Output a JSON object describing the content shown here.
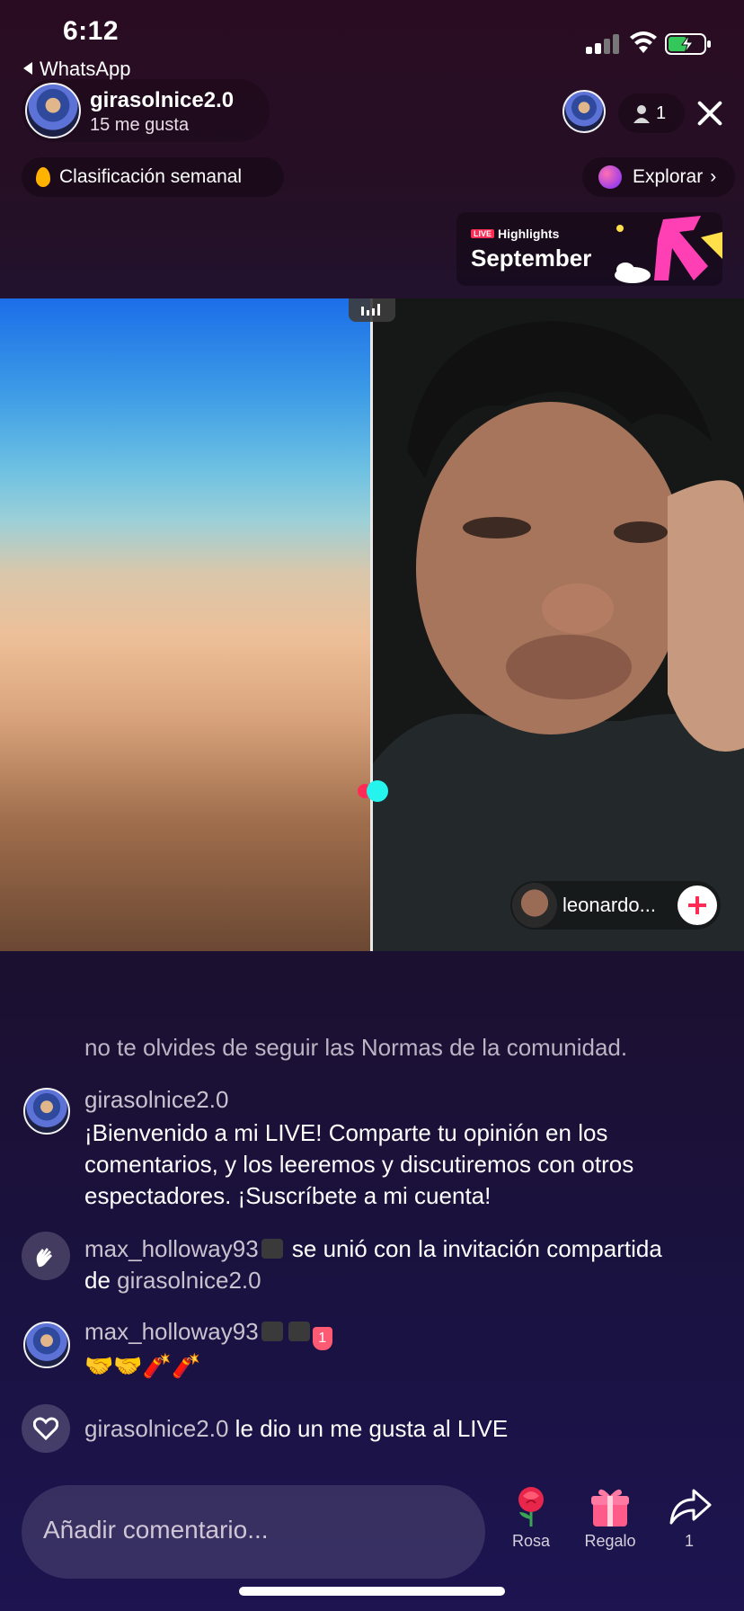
{
  "status_bar": {
    "time": "6:12",
    "back_app": "WhatsApp"
  },
  "host": {
    "name": "girasolnice2.0",
    "likes": "15 me gusta"
  },
  "viewers": {
    "count": "1"
  },
  "weekly_ranking": {
    "label": "Clasificación semanal"
  },
  "explore": {
    "label": "Explorar"
  },
  "highlights": {
    "badge": "LIVE",
    "title": "Highlights",
    "month": "September"
  },
  "guest": {
    "name": "leonardo..."
  },
  "chat": {
    "notice": "no te olvides de seguir las Normas de la comunidad.",
    "messages": [
      {
        "user": "girasolnice2.0",
        "text": "¡Bienvenido a mi LIVE! Comparte tu opinión en los comentarios, y los leeremos y discutiremos con otros espectadores. ¡Suscríbete a mi cuenta!"
      },
      {
        "user": "max_holloway93",
        "text": "se unió con la invitación compartida",
        "text2": "de",
        "ref_user": "girasolnice2.0"
      },
      {
        "user": "max_holloway93",
        "text": "🤝🤝🧨🧨",
        "rank_badge": "1"
      },
      {
        "user": "girasolnice2.0",
        "text": "le dio un me gusta al LIVE"
      }
    ]
  },
  "composer": {
    "placeholder": "Añadir comentario..."
  },
  "actions": {
    "rose": "Rosa",
    "gift": "Regalo",
    "share_count": "1"
  },
  "colors": {
    "accent": "#fe2c55",
    "cyan": "#25f4ee"
  }
}
